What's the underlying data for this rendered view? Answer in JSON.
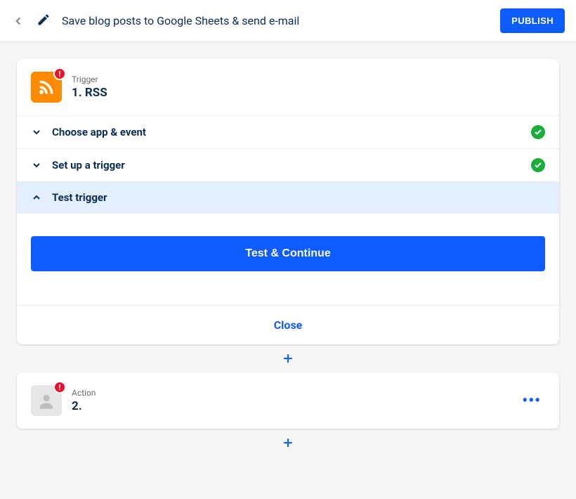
{
  "header": {
    "title": "Save blog posts to Google Sheets & send e-mail",
    "publish_label": "PUBLISH"
  },
  "step1": {
    "type_label": "Trigger",
    "title": "1. RSS",
    "sections": {
      "choose": "Choose app & event",
      "setup": "Set up a trigger",
      "test": "Test trigger"
    },
    "test_button": "Test & Continue",
    "close_label": "Close"
  },
  "step2": {
    "type_label": "Action",
    "title": "2."
  },
  "icons": {
    "rss_color": "#ff8a00",
    "alert_color": "#e8142c",
    "success_color": "#1aad3b",
    "primary_color": "#0d5cff"
  }
}
